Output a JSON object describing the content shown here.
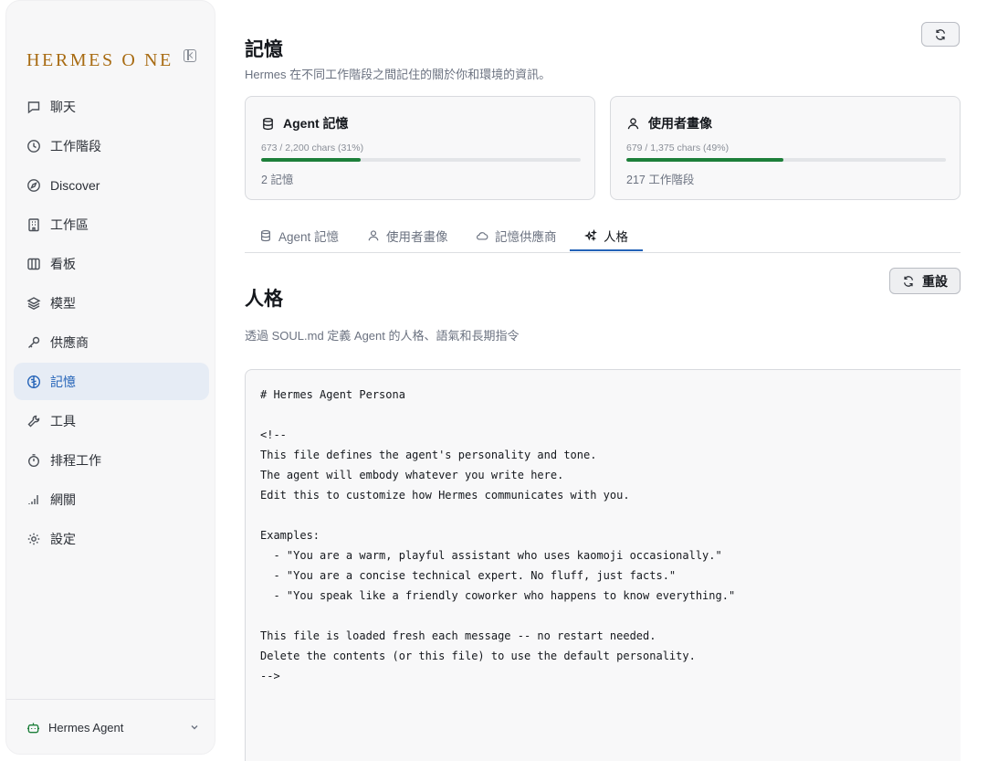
{
  "sidebar": {
    "brand": "HERMES O NE",
    "items": [
      {
        "label": "聊天",
        "icon": "chat-icon"
      },
      {
        "label": "工作階段",
        "icon": "clock-icon"
      },
      {
        "label": "Discover",
        "icon": "compass-icon"
      },
      {
        "label": "工作區",
        "icon": "building-icon"
      },
      {
        "label": "看板",
        "icon": "columns-icon"
      },
      {
        "label": "模型",
        "icon": "layers-icon"
      },
      {
        "label": "供應商",
        "icon": "key-icon"
      },
      {
        "label": "記憶",
        "icon": "brain-icon",
        "active": true
      },
      {
        "label": "工具",
        "icon": "wrench-icon"
      },
      {
        "label": "排程工作",
        "icon": "timer-icon"
      },
      {
        "label": "網關",
        "icon": "signal-icon"
      },
      {
        "label": "設定",
        "icon": "gear-icon"
      }
    ],
    "agent": "Hermes Agent"
  },
  "header": {
    "title": "記憶",
    "subtitle": "Hermes 在不同工作階段之間記住的關於你和環境的資訊。"
  },
  "cards": {
    "agent": {
      "title": "Agent 記憶",
      "usage": "673 / 2,200 chars (31%)",
      "fraction": 0.31,
      "count": "2 記憶"
    },
    "user": {
      "title": "使用者畫像",
      "usage": "679 / 1,375 chars (49%)",
      "fraction": 0.49,
      "count": "217 工作階段"
    }
  },
  "tabs": [
    {
      "label": "Agent 記憶",
      "icon": "database-icon"
    },
    {
      "label": "使用者畫像",
      "icon": "user-icon"
    },
    {
      "label": "記憶供應商",
      "icon": "cloud-icon"
    },
    {
      "label": "人格",
      "icon": "sparkles-icon",
      "active": true
    }
  ],
  "persona": {
    "title": "人格",
    "subtitle": "透過 SOUL.md 定義 Agent 的人格、語氣和長期指令",
    "reset_label": "重設",
    "content": "# Hermes Agent Persona\n\n<!--\nThis file defines the agent's personality and tone.\nThe agent will embody whatever you write here.\nEdit this to customize how Hermes communicates with you.\n\nExamples:\n  - \"You are a warm, playful assistant who uses kaomoji occasionally.\"\n  - \"You are a concise technical expert. No fluff, just facts.\"\n  - \"You speak like a friendly coworker who happens to know everything.\"\n\nThis file is loaded fresh each message -- no restart needed.\nDelete the contents (or this file) to use the default personality.\n-->"
  },
  "colors": {
    "accent": "#2463b8",
    "brand": "#a86b12",
    "progress": "#1d7f3a"
  }
}
